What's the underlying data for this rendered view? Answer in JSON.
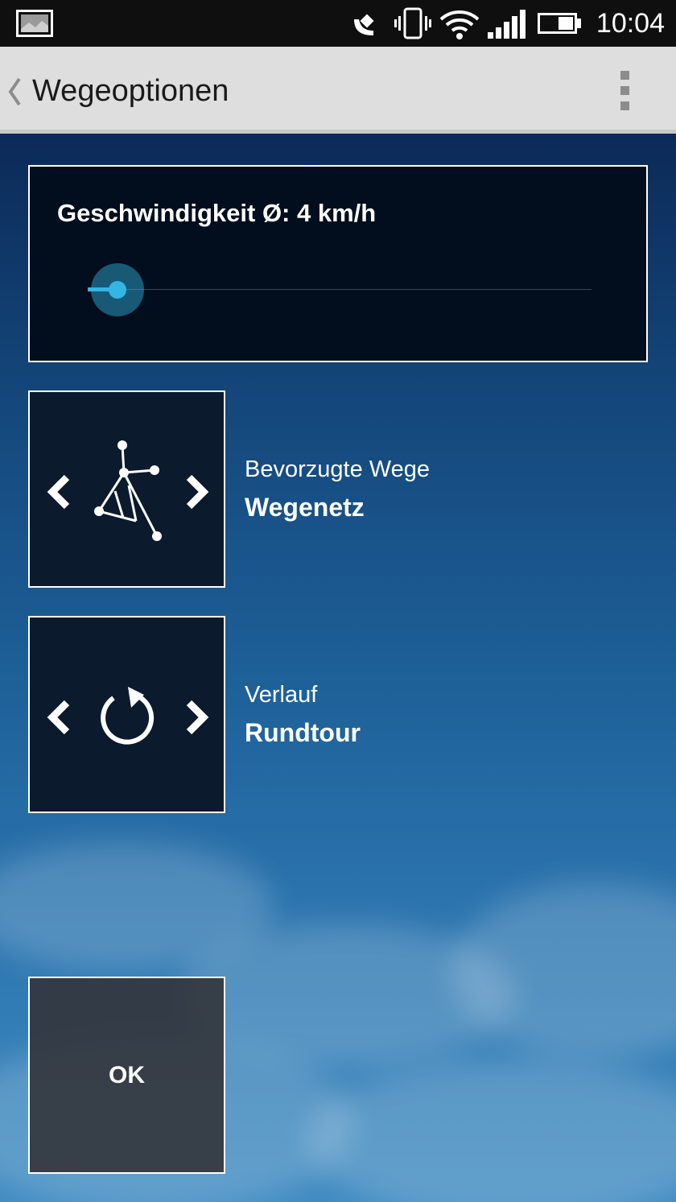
{
  "status_bar": {
    "time": "10:04",
    "icons": [
      "gallery-notification-icon",
      "satellite-icon",
      "vibrate-icon",
      "wifi-icon",
      "signal-icon",
      "battery-icon"
    ]
  },
  "action_bar": {
    "title": "Wegeoptionen",
    "back_icon": "chevron-left-icon",
    "menu_icon": "overflow-menu-icon"
  },
  "speed": {
    "label": "Geschwindigkeit Ø: 4 km/h",
    "slider_fraction": 0.06,
    "accent_color": "#33b5e5"
  },
  "preferred_paths": {
    "caption": "Bevorzugte Wege",
    "value": "Wegenetz",
    "icon": "path-network-icon"
  },
  "route_type": {
    "caption": "Verlauf",
    "value": "Rundtour",
    "icon": "round-trip-icon"
  },
  "ok_button": {
    "label": "OK"
  }
}
